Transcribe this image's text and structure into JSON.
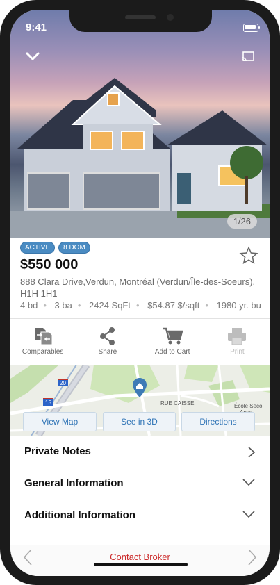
{
  "status": {
    "time": "9:41"
  },
  "hero": {
    "photo_counter": "1/26"
  },
  "listing": {
    "badges": [
      "ACTIVE",
      "8 DOM"
    ],
    "price": "$550 000",
    "address": "888 Clara Drive,Verdun, Montréal (Verdun/Île-des-Soeurs), H1H 1H1",
    "specs": [
      "4 bd",
      "3 ba",
      "2424 SqFt",
      "$54.87 $/sqft",
      "1980 yr. bu"
    ]
  },
  "actions": [
    {
      "label": "Comparables",
      "icon": "comparables-icon"
    },
    {
      "label": "Share",
      "icon": "share-icon"
    },
    {
      "label": "Add to Cart",
      "icon": "cart-icon"
    },
    {
      "label": "Print",
      "icon": "print-icon"
    }
  ],
  "map": {
    "buttons": [
      "View Map",
      "See in 3D",
      "Directions"
    ],
    "labels": {
      "street": "RUE CAISSE",
      "school": "École Seco",
      "school2": "Anse",
      "route20": "20",
      "route15": "15"
    }
  },
  "sections": [
    {
      "title": "Private Notes",
      "icon": "chevron-right-icon"
    },
    {
      "title": "General Information",
      "icon": "chevron-down-icon"
    },
    {
      "title": "Additional Information",
      "icon": "chevron-down-icon"
    }
  ],
  "footer": {
    "contact_label": "Contact Broker"
  },
  "colors": {
    "accent": "#4a8bc2",
    "contact": "#cc2b2b",
    "link": "#2d72b5"
  }
}
